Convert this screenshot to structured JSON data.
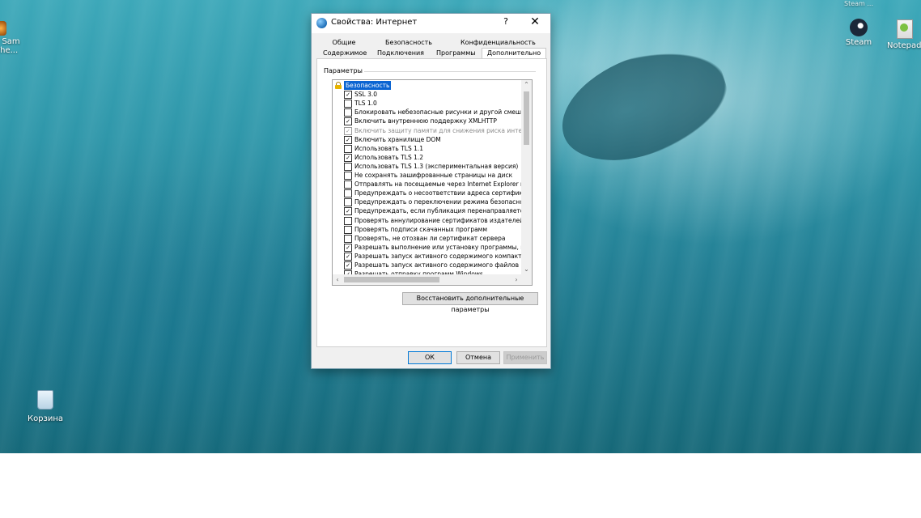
{
  "desktop": {
    "partial_icon_label_line1": "s Sam",
    "partial_icon_label_line2": "The...",
    "steam_label": "Steam",
    "steam_top_label": "Steam ...",
    "notepad_label": "Notepad+",
    "recycle_label": "Корзина"
  },
  "window": {
    "title": "Свойства: Интернет",
    "help": "?",
    "close": "✕"
  },
  "tabs": {
    "row1": [
      "Общие",
      "Безопасность",
      "Конфиденциальность"
    ],
    "row2": [
      "Содержимое",
      "Подключения",
      "Программы",
      "Дополнительно"
    ],
    "active": "Дополнительно"
  },
  "settings": {
    "group_label": "Параметры",
    "category": "Безопасность",
    "items": [
      {
        "label": "SSL 3.0",
        "checked": true,
        "dim": false
      },
      {
        "label": "TLS 1.0",
        "checked": false,
        "dim": false
      },
      {
        "label": "Блокировать небезопасные рисунки и другой смешанн",
        "checked": false,
        "dim": false
      },
      {
        "label": "Включить внутреннюю поддержку XMLHTTP",
        "checked": true,
        "dim": false
      },
      {
        "label": "Включить защиту памяти для снижения риска интернет",
        "checked": true,
        "dim": true
      },
      {
        "label": "Включить хранилище DOM",
        "checked": true,
        "dim": false
      },
      {
        "label": "Использовать TLS 1.1",
        "checked": false,
        "dim": false
      },
      {
        "label": "Использовать TLS 1.2",
        "checked": true,
        "dim": false
      },
      {
        "label": "Использовать TLS 1.3 (экспериментальная версия)",
        "checked": false,
        "dim": false
      },
      {
        "label": "Не сохранять зашифрованные страницы на диск",
        "checked": false,
        "dim": false
      },
      {
        "label": "Отправлять на посещаемые через Internet Explorer веб",
        "checked": false,
        "dim": false
      },
      {
        "label": "Предупреждать о несоответствии адреса сертификата",
        "checked": false,
        "dim": false
      },
      {
        "label": "Предупреждать о переключении режима безопасности",
        "checked": false,
        "dim": false
      },
      {
        "label": "Предупреждать, если публикация перенаправляется в",
        "checked": true,
        "dim": false
      },
      {
        "label": "Проверять аннулирование сертификатов издателей",
        "checked": false,
        "dim": false
      },
      {
        "label": "Проверять подписи скачанных программ",
        "checked": false,
        "dim": false
      },
      {
        "label": "Проверять, не отозван ли сертификат сервера",
        "checked": false,
        "dim": false
      },
      {
        "label": "Разрешать выполнение или установку программы, имен",
        "checked": true,
        "dim": false
      },
      {
        "label": "Разрешать запуск активного содержимого компакт-дис",
        "checked": true,
        "dim": false
      },
      {
        "label": "Разрешать запуск активного содержимого файлов на м",
        "checked": true,
        "dim": false
      },
      {
        "label": "Разрешать отправку программ Windows...",
        "checked": true,
        "dim": false
      }
    ]
  },
  "buttons": {
    "restore": "Восстановить дополнительные параметры",
    "ok": "ОК",
    "cancel": "Отмена",
    "apply": "Применить"
  },
  "icons": {
    "check": "✓",
    "scroll_up": "⌃",
    "scroll_down": "⌄",
    "scroll_left": "‹",
    "scroll_right": "›"
  }
}
